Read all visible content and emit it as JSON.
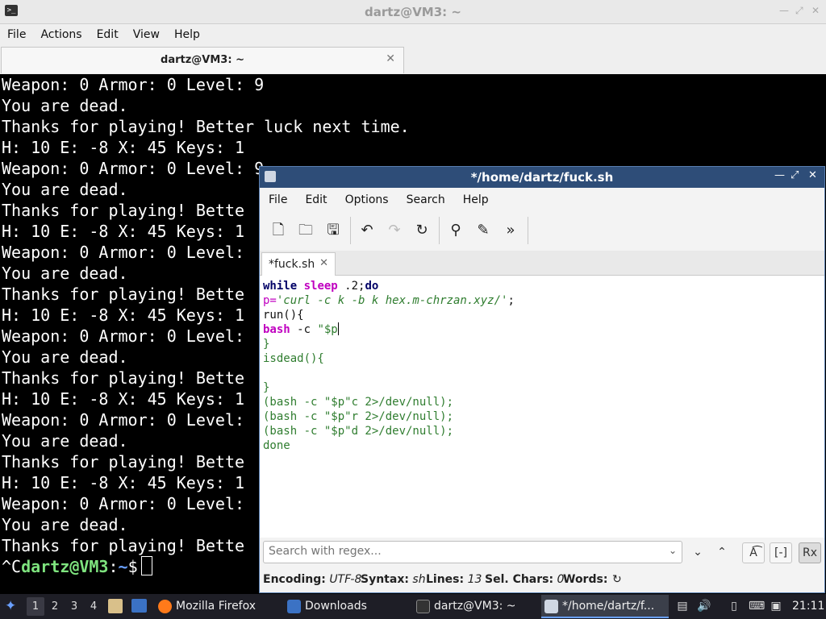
{
  "terminal": {
    "window_title": "dartz@VM3: ~",
    "menu": [
      "File",
      "Actions",
      "Edit",
      "View",
      "Help"
    ],
    "tab_label": "dartz@VM3: ~",
    "lines": [
      "Weapon: 0 Armor: 0 Level: 9",
      "You are dead.",
      "Thanks for playing! Better luck next time.",
      "H: 10 E: -8 X: 45 Keys: 1",
      "Weapon: 0 Armor: 0 Level: 9",
      "You are dead.",
      "Thanks for playing! Bette",
      "H: 10 E: -8 X: 45 Keys: 1",
      "Weapon: 0 Armor: 0 Level:",
      "You are dead.",
      "Thanks for playing! Bette",
      "H: 10 E: -8 X: 45 Keys: 1",
      "Weapon: 0 Armor: 0 Level:",
      "You are dead.",
      "Thanks for playing! Bette",
      "H: 10 E: -8 X: 45 Keys: 1",
      "Weapon: 0 Armor: 0 Level:",
      "You are dead.",
      "Thanks for playing! Bette",
      "H: 10 E: -8 X: 45 Keys: 1",
      "Weapon: 0 Armor: 0 Level:",
      "You are dead.",
      "Thanks for playing! Bette"
    ],
    "prompt": {
      "prefix": "^C",
      "user": "dartz@VM3",
      "sep": ":",
      "path": "~",
      "symbol": "$"
    }
  },
  "editor": {
    "window_title": "*/home/dartz/fuck.sh",
    "menu": [
      "File",
      "Edit",
      "Options",
      "Search",
      "Help"
    ],
    "toolbar": [
      "new-file-icon",
      "open-folder-icon",
      "save-icon",
      "undo-icon",
      "redo-icon",
      "reload-icon",
      "search-icon",
      "replace-icon",
      "more-icon"
    ],
    "tab_label": "*fuck.sh",
    "code": {
      "l1_kw1": "while",
      "l1_kw2": "sleep",
      "l1_rest": " .2;",
      "l1_kw3": "do",
      "l2_var": "p=",
      "l2_str": "'curl -c k -b k hex.m-chrzan.xyz/'",
      "l2_end": ";",
      "l3": "run(){",
      "l4_cmd": "bash",
      "l4_rest": " -c ",
      "l4_str": "\"$p",
      "l5": "}",
      "l6": "isdead(){",
      "l7": "",
      "l8": "}",
      "l9": "(bash -c \"$p\"c 2>/dev/null);",
      "l10": "(bash -c \"$p\"r 2>/dev/null);",
      "l11": "(bash -c \"$p\"d 2>/dev/null);",
      "l12": "done"
    },
    "search": {
      "placeholder": "Search with regex...",
      "value": ""
    },
    "status": {
      "encoding_label": "Encoding:",
      "encoding": "UTF-8",
      "syntax_label": "Syntax:",
      "syntax": "sh",
      "lines_label": "Lines:",
      "lines": "13",
      "sel_label": "Sel. Chars:",
      "sel": "0",
      "words_label": "Words:"
    }
  },
  "taskbar": {
    "workspaces": [
      "1",
      "2",
      "3",
      "4"
    ],
    "tasks": [
      {
        "label": "Mozilla Firefox"
      },
      {
        "label": "Downloads"
      },
      {
        "label": "dartz@VM3: ~"
      },
      {
        "label": "*/home/dartz/f..."
      }
    ],
    "clock": "21:11"
  }
}
